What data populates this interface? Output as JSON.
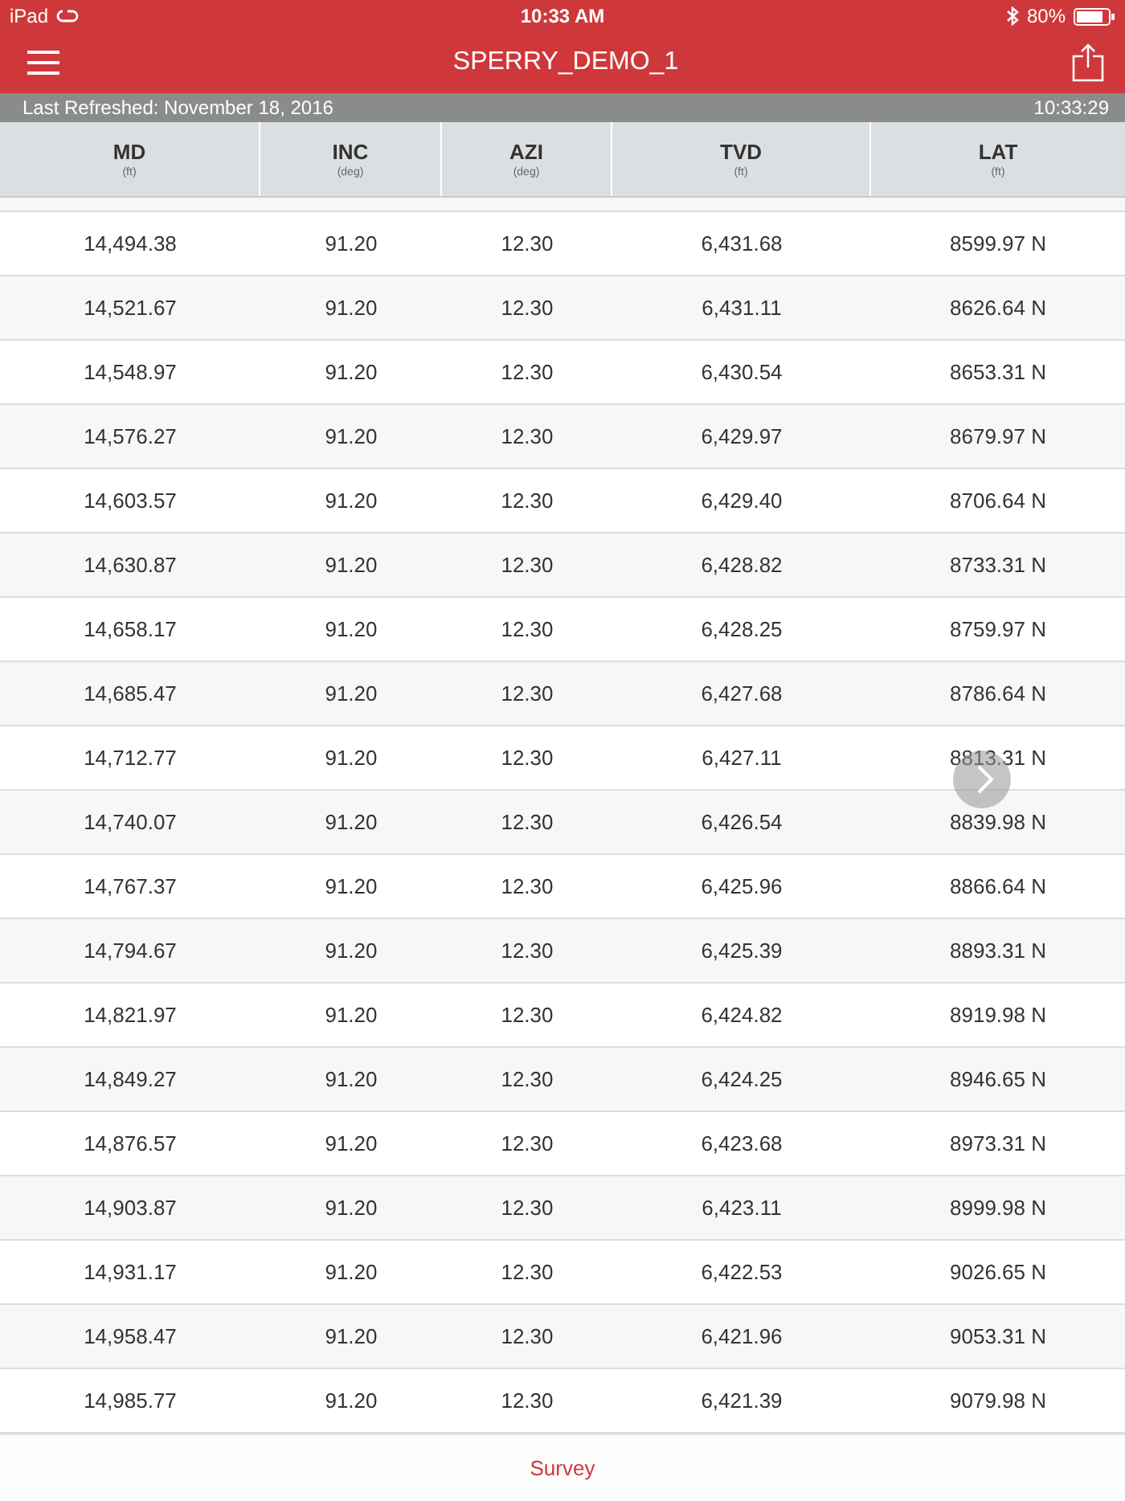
{
  "status_bar": {
    "device": "iPad",
    "time": "10:33 AM",
    "battery": "80%"
  },
  "nav_bar": {
    "title": "SPERRY_DEMO_1"
  },
  "refresh_bar": {
    "label": "Last Refreshed: November 18, 2016",
    "time": "10:33:29"
  },
  "table": {
    "columns": [
      {
        "name": "MD",
        "unit": "(ft)"
      },
      {
        "name": "INC",
        "unit": "(deg)"
      },
      {
        "name": "AZI",
        "unit": "(deg)"
      },
      {
        "name": "TVD",
        "unit": "(ft)"
      },
      {
        "name": "LAT",
        "unit": "(ft)"
      }
    ],
    "rows": [
      [
        "14,494.38",
        "91.20",
        "12.30",
        "6,431.68",
        "8599.97 N"
      ],
      [
        "14,521.67",
        "91.20",
        "12.30",
        "6,431.11",
        "8626.64 N"
      ],
      [
        "14,548.97",
        "91.20",
        "12.30",
        "6,430.54",
        "8653.31 N"
      ],
      [
        "14,576.27",
        "91.20",
        "12.30",
        "6,429.97",
        "8679.97 N"
      ],
      [
        "14,603.57",
        "91.20",
        "12.30",
        "6,429.40",
        "8706.64 N"
      ],
      [
        "14,630.87",
        "91.20",
        "12.30",
        "6,428.82",
        "8733.31 N"
      ],
      [
        "14,658.17",
        "91.20",
        "12.30",
        "6,428.25",
        "8759.97 N"
      ],
      [
        "14,685.47",
        "91.20",
        "12.30",
        "6,427.68",
        "8786.64 N"
      ],
      [
        "14,712.77",
        "91.20",
        "12.30",
        "6,427.11",
        "8813.31 N"
      ],
      [
        "14,740.07",
        "91.20",
        "12.30",
        "6,426.54",
        "8839.98 N"
      ],
      [
        "14,767.37",
        "91.20",
        "12.30",
        "6,425.96",
        "8866.64 N"
      ],
      [
        "14,794.67",
        "91.20",
        "12.30",
        "6,425.39",
        "8893.31 N"
      ],
      [
        "14,821.97",
        "91.20",
        "12.30",
        "6,424.82",
        "8919.98 N"
      ],
      [
        "14,849.27",
        "91.20",
        "12.30",
        "6,424.25",
        "8946.65 N"
      ],
      [
        "14,876.57",
        "91.20",
        "12.30",
        "6,423.68",
        "8973.31 N"
      ],
      [
        "14,903.87",
        "91.20",
        "12.30",
        "6,423.11",
        "8999.98 N"
      ],
      [
        "14,931.17",
        "91.20",
        "12.30",
        "6,422.53",
        "9026.65 N"
      ],
      [
        "14,958.47",
        "91.20",
        "12.30",
        "6,421.96",
        "9053.31 N"
      ],
      [
        "14,985.77",
        "91.20",
        "12.30",
        "6,421.39",
        "9079.98 N"
      ]
    ]
  },
  "tab_bar": {
    "label": "Survey"
  }
}
